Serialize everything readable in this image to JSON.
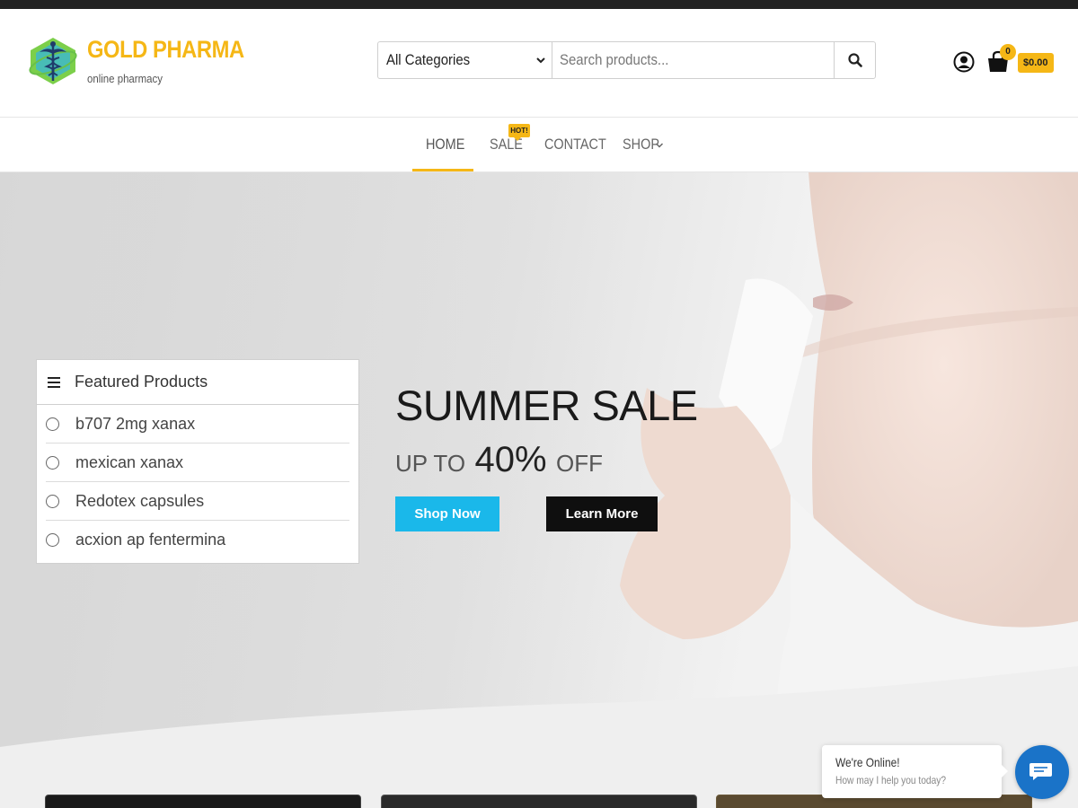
{
  "header": {
    "brand_name": "GOLD PHARMA",
    "brand_tagline": "online pharmacy",
    "logo_icon": "caduceus-logo",
    "accent_color": "#f5b716"
  },
  "search": {
    "category_value": "All Categories",
    "placeholder": "Search products...",
    "button_icon": "search-icon"
  },
  "account": {
    "icon": "user-circle-icon"
  },
  "cart": {
    "icon": "shopping-bag-icon",
    "count": "0",
    "total": "$0.00"
  },
  "nav": {
    "home": "HOME",
    "sale": "SALE",
    "sale_badge": "HOT!",
    "contact": "CONTACT",
    "shop": "SHOP",
    "active": "HOME"
  },
  "featured": {
    "title": "Featured Products",
    "items": [
      {
        "label": "b707 2mg xanax"
      },
      {
        "label": "mexican xanax"
      },
      {
        "label": "Redotex capsules"
      },
      {
        "label": "acxion ap fentermina"
      }
    ]
  },
  "hero": {
    "title": "SUMMER SALE",
    "up_to": "UP TO",
    "percent": "40%",
    "off": "OFF",
    "shop_button": "Shop Now",
    "learn_button": "Learn More",
    "shop_button_color": "#1ab8ea"
  },
  "chat": {
    "status": "We're Online!",
    "prompt": "How may I help you today?",
    "button_color": "#1a73c8"
  }
}
